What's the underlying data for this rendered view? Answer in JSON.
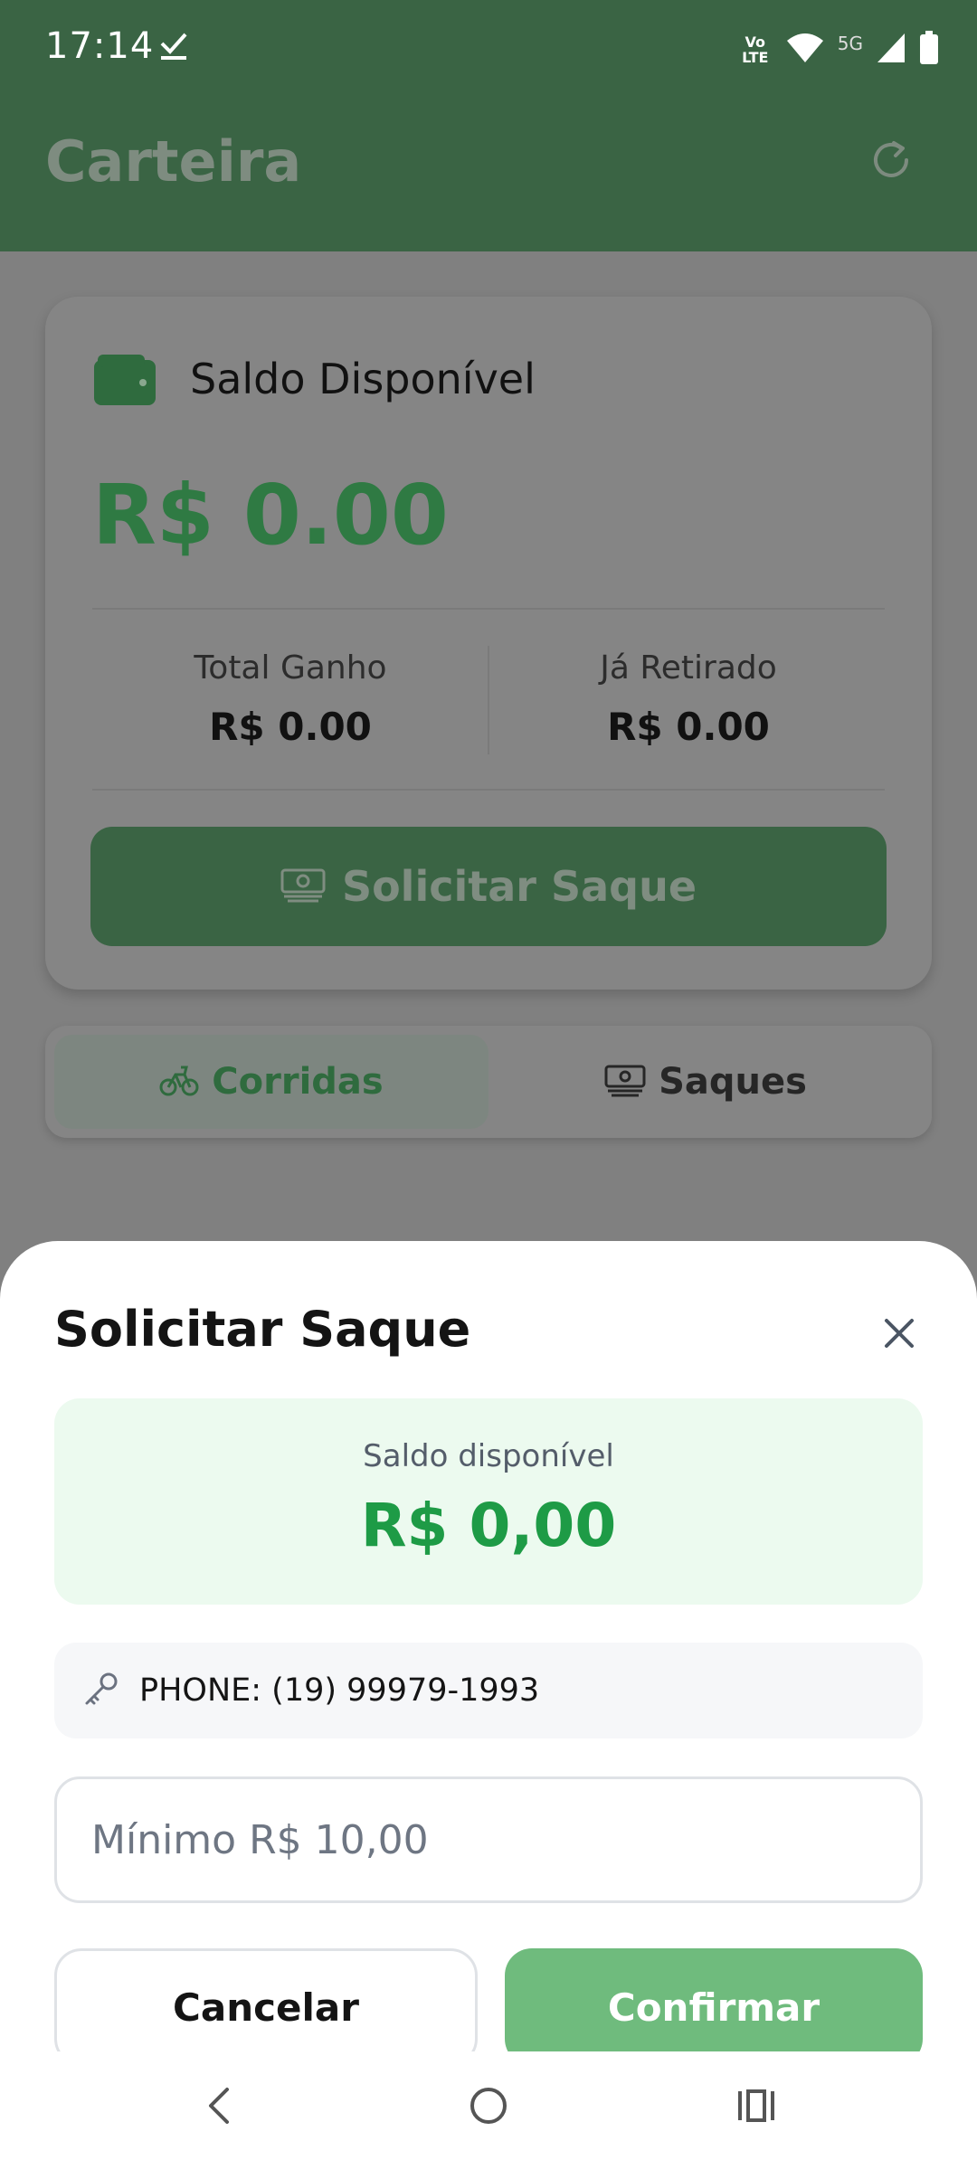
{
  "status_bar": {
    "time": "17:14",
    "network_label": "5G",
    "volte_label": "Vo LTE",
    "icons": [
      "check-icon",
      "volte-icon",
      "wifi-icon",
      "signal-icon",
      "battery-icon"
    ]
  },
  "app_bar": {
    "title": "Carteira",
    "refresh_icon": "refresh-icon"
  },
  "balance_card": {
    "label": "Saldo Disponível",
    "value": "R$ 0.00",
    "total_earned_label": "Total Ganho",
    "total_earned_value": "R$ 0.00",
    "withdrawn_label": "Já Retirado",
    "withdrawn_value": "R$ 0.00",
    "withdraw_button_label": "Solicitar Saque"
  },
  "tabs": [
    {
      "label": "Corridas",
      "icon": "bike-icon",
      "active": true
    },
    {
      "label": "Saques",
      "icon": "money-icon",
      "active": false
    }
  ],
  "sheet": {
    "title": "Solicitar Saque",
    "available_label": "Saldo disponível",
    "available_value": "R$ 0,00",
    "pix_key": "PHONE: (19) 99979-1993",
    "amount_input": {
      "value": "",
      "placeholder": "Mínimo R$ 10,00"
    },
    "cancel_label": "Cancelar",
    "confirm_label": "Confirmar"
  },
  "colors": {
    "primary": "#3a6444",
    "accent_green": "#1e9b46",
    "confirm_button": "#6fbb7d",
    "available_bg": "#ecfaef"
  }
}
